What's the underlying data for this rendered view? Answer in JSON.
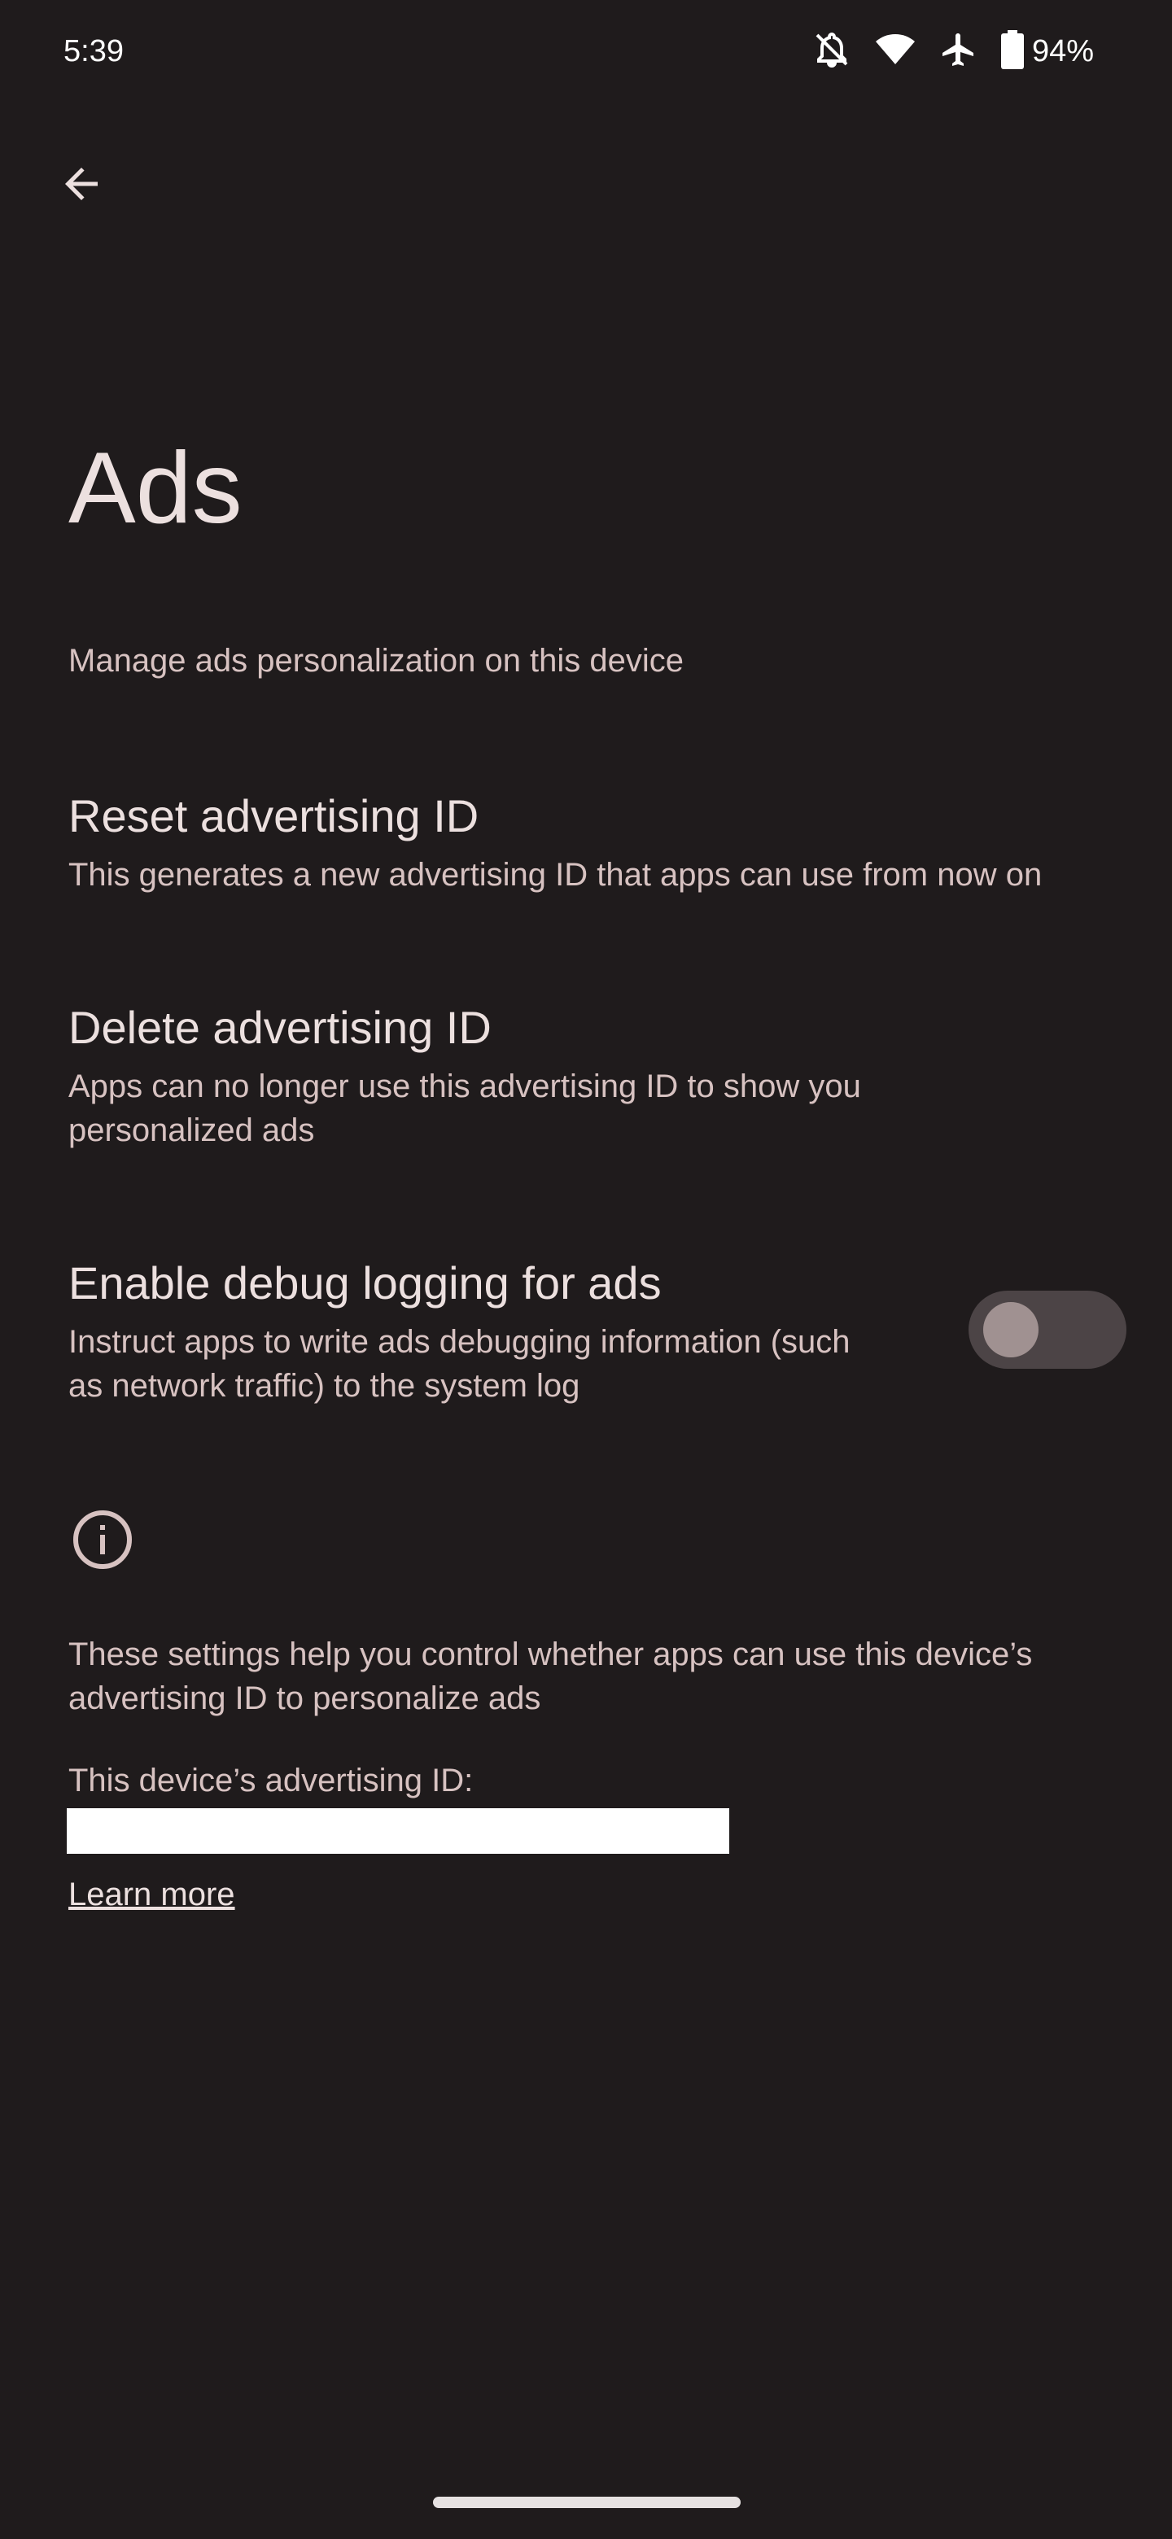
{
  "status_bar": {
    "time": "5:39",
    "battery": "94%",
    "icons": [
      "bell-off-icon",
      "wifi-icon",
      "airplane-icon",
      "battery-icon"
    ]
  },
  "header": {
    "back_icon": "arrow-back-icon"
  },
  "page": {
    "title": "Ads",
    "description": "Manage ads personalization on this device"
  },
  "preferences": [
    {
      "title": "Reset advertising ID",
      "summary": "This generates a new advertising ID that apps can use from now on"
    },
    {
      "title": "Delete advertising ID",
      "summary": "Apps can no longer use this advertising ID to show you personalized ads"
    },
    {
      "title": "Enable debug logging for ads",
      "summary": "Instruct apps to write ads debugging information (such as network traffic) to the system log",
      "toggle_on": false
    }
  ],
  "footer": {
    "info_icon": "info-icon",
    "text": "These settings help you control whether apps can use this device’s advertising ID to personalize ads",
    "id_label": "This device’s advertising ID:",
    "id_value": "",
    "learn_more": "Learn more"
  },
  "colors": {
    "background": "#1f1b1c",
    "primary_text": "#ece0df",
    "secondary_text": "#d7c2c1",
    "toggle_track": "#4c4446",
    "toggle_knob": "#a09191"
  }
}
